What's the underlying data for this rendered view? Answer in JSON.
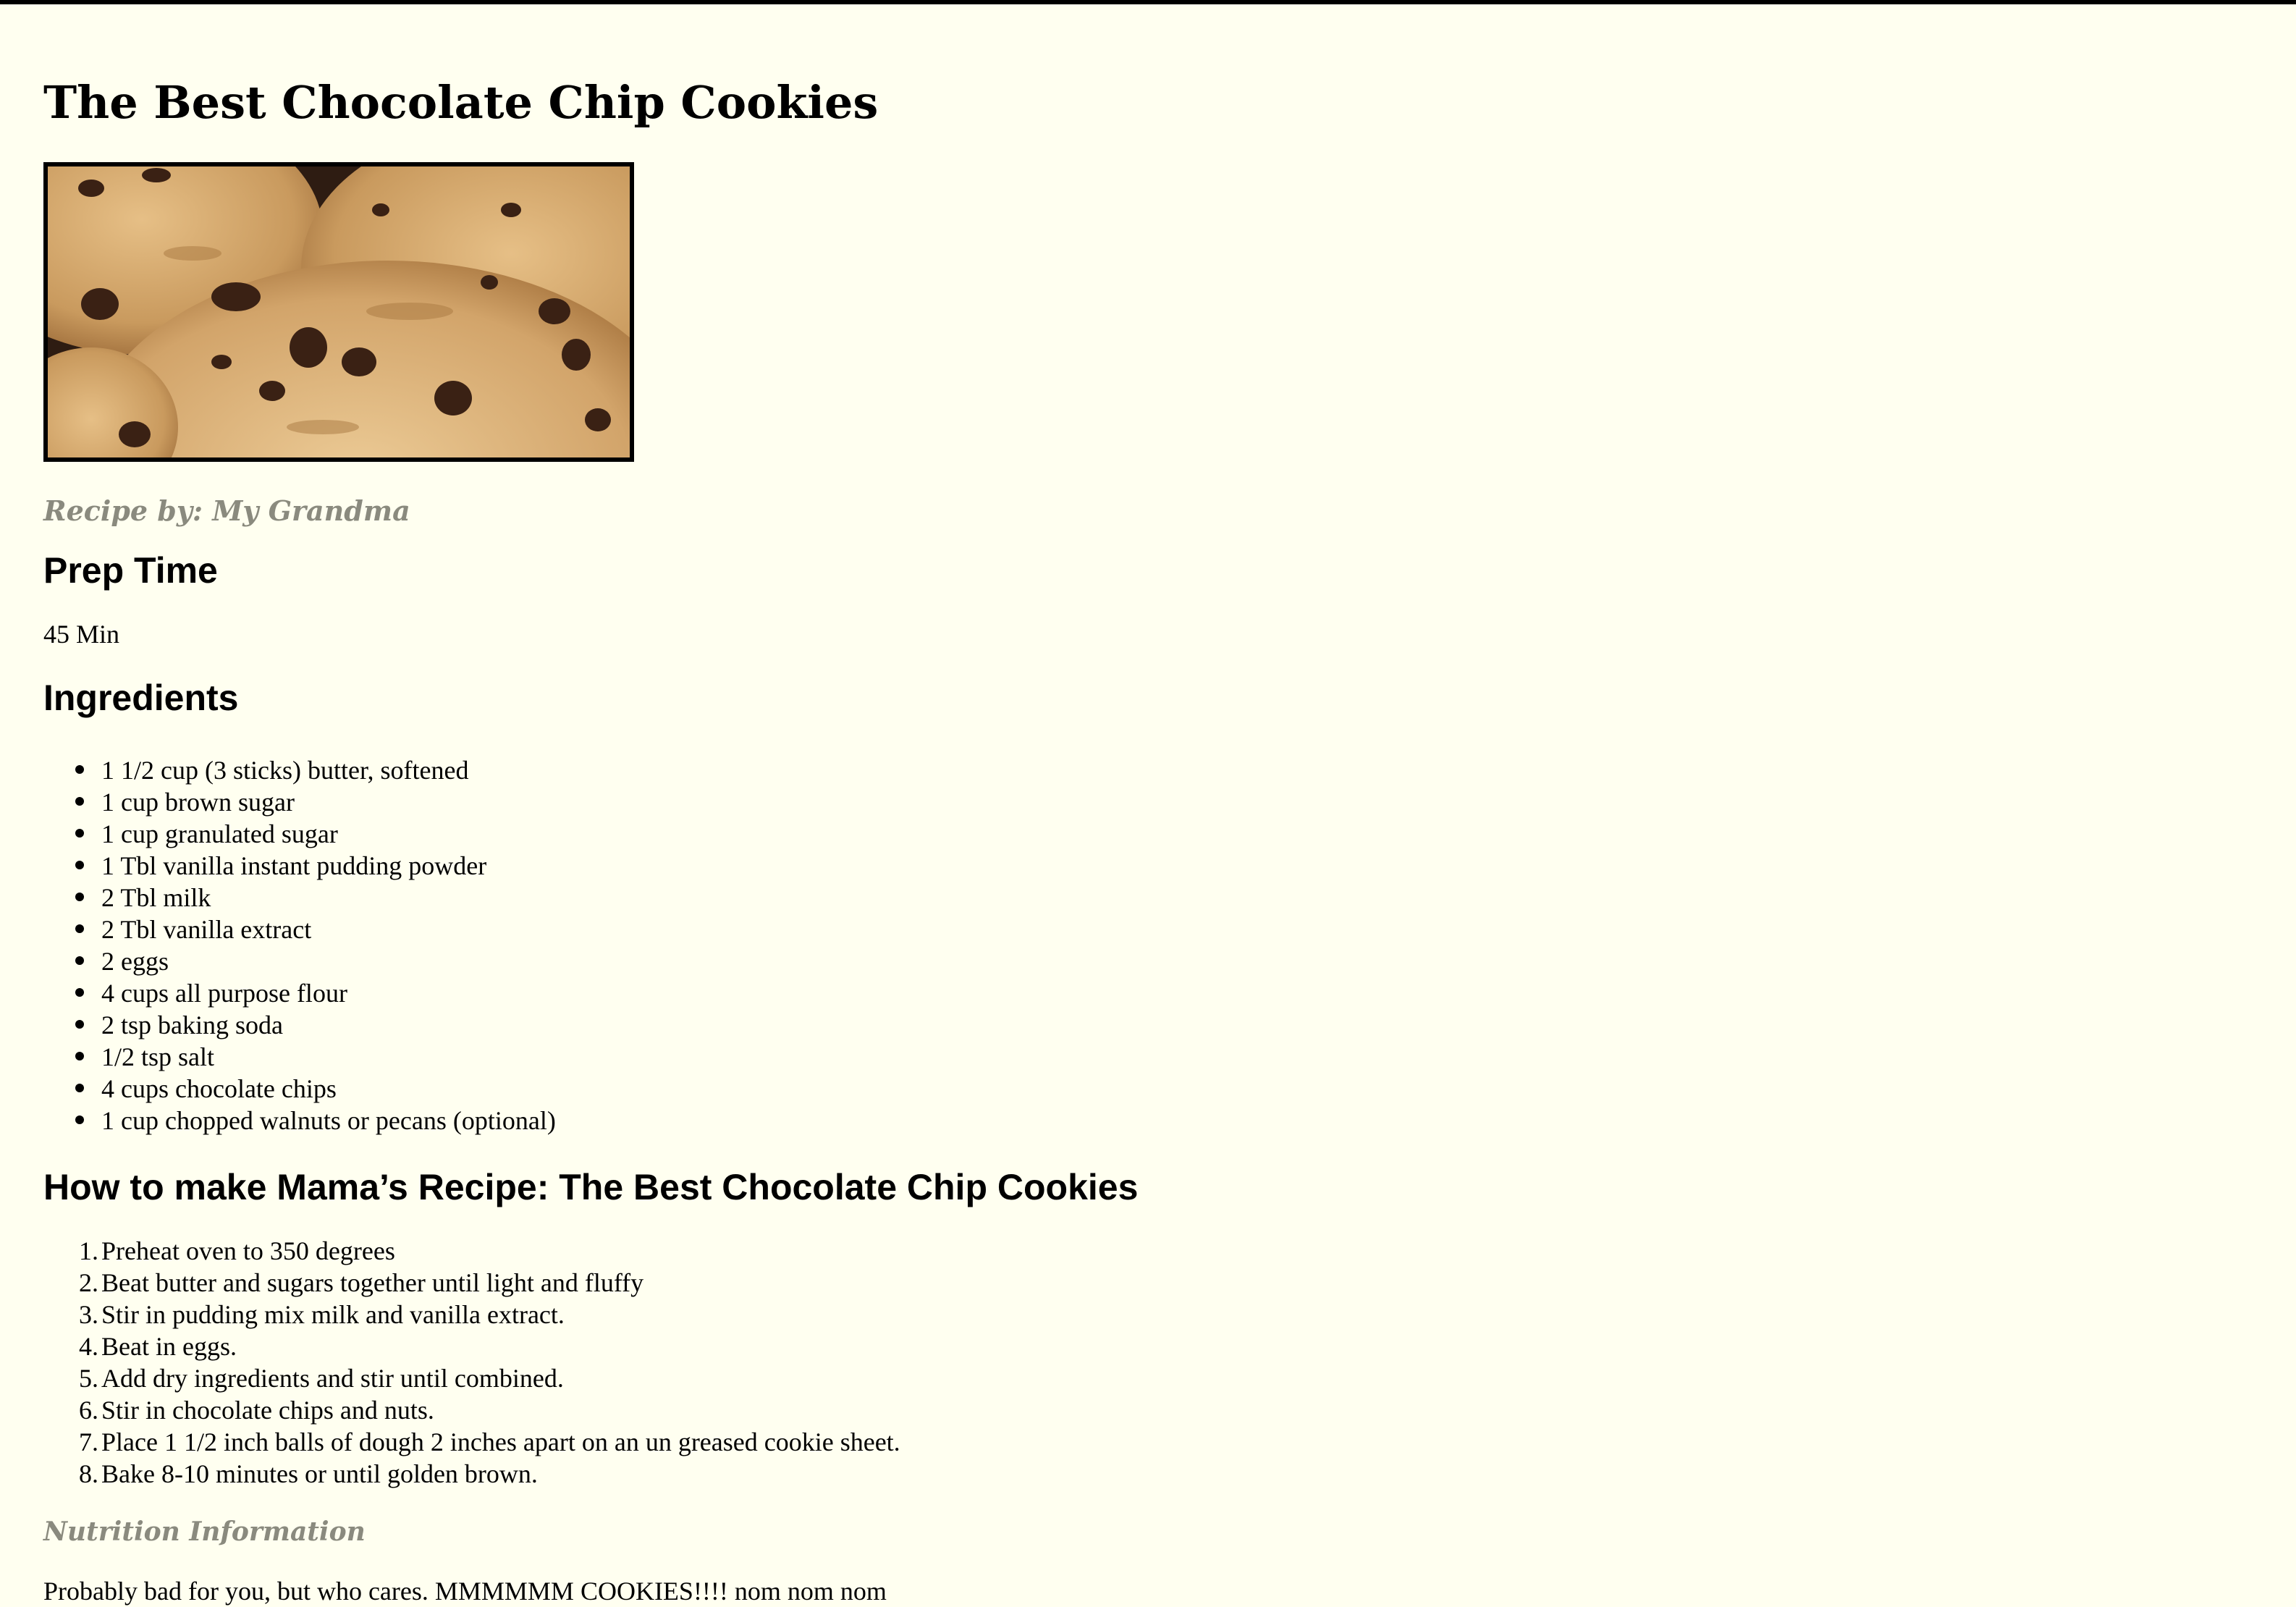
{
  "page": {
    "background": "#fffff0",
    "title": "The Best Chocolate Chip Cookies",
    "hero_image": {
      "icon": "chocolate-chip-cookies-photo"
    },
    "byline": "Recipe by: My Grandma"
  },
  "prep": {
    "heading": "Prep Time",
    "value": "45 Min"
  },
  "ingredients": {
    "heading": "Ingredients",
    "items": [
      "1 1/2 cup (3 sticks) butter, softened",
      "1 cup brown sugar",
      "1 cup granulated sugar",
      "1 Tbl vanilla instant pudding powder",
      "2 Tbl milk",
      "2 Tbl vanilla extract",
      "2 eggs",
      "4 cups all purpose flour",
      "2 tsp baking soda",
      "1/2 tsp salt",
      "4 cups chocolate chips",
      "1 cup chopped walnuts or pecans (optional)"
    ]
  },
  "directions": {
    "heading": "How to make Mama’s Recipe: The Best Chocolate Chip Cookies",
    "steps": [
      {
        "num": "1.",
        "text": "Preheat oven to 350 degrees"
      },
      {
        "num": "2.",
        "text": "Beat butter and sugars together until light and fluffy"
      },
      {
        "num": "3.",
        "text": "Stir in pudding mix milk and vanilla extract."
      },
      {
        "num": "4.",
        "text": "Beat in eggs."
      },
      {
        "num": "5.",
        "text": "Add dry ingredients and stir until combined."
      },
      {
        "num": "6.",
        "text": "Stir in chocolate chips and nuts."
      },
      {
        "num": "7.",
        "text": "Place 1 1/2 inch balls of dough 2 inches apart on an un greased cookie sheet."
      },
      {
        "num": "8.",
        "text": "Bake 8-10 minutes or until golden brown."
      }
    ]
  },
  "nutrition": {
    "heading": "Nutrition Information",
    "text": "Probably bad for you, but who cares. MMMMMM COOKIES!!!! nom nom nom"
  }
}
